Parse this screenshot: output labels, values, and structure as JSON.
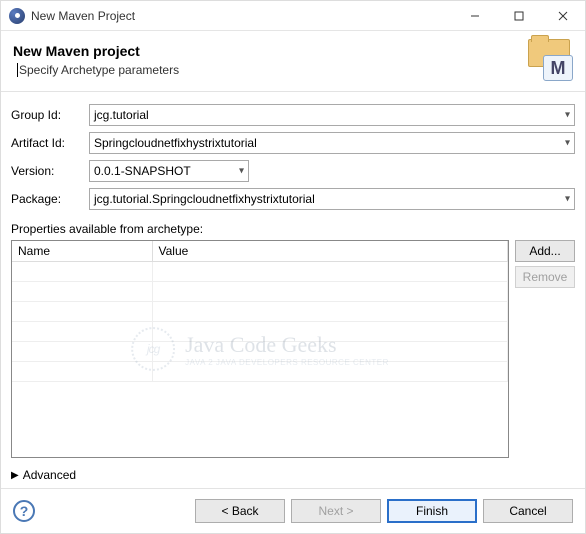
{
  "window": {
    "title": "New Maven Project"
  },
  "header": {
    "title": "New Maven project",
    "subtitle": "Specify Archetype parameters"
  },
  "form": {
    "groupId": {
      "label": "Group Id:",
      "value": "jcg.tutorial"
    },
    "artifactId": {
      "label": "Artifact Id:",
      "value": "Springcloudnetfixhystrixtutorial"
    },
    "version": {
      "label": "Version:",
      "value": "0.0.1-SNAPSHOT"
    },
    "package": {
      "label": "Package:",
      "value": "jcg.tutorial.Springcloudnetfixhystrixtutorial"
    }
  },
  "propsSection": {
    "label": "Properties available from archetype:",
    "columns": {
      "name": "Name",
      "value": "Value"
    },
    "buttons": {
      "add": "Add...",
      "remove": "Remove"
    }
  },
  "advanced": {
    "label": "Advanced"
  },
  "footer": {
    "back": "< Back",
    "next": "Next >",
    "finish": "Finish",
    "cancel": "Cancel"
  },
  "watermark": {
    "badge": "jcg",
    "title": "Java Code Geeks",
    "subtitle": "JAVA 2 JAVA DEVELOPERS RESOURCE CENTER"
  }
}
